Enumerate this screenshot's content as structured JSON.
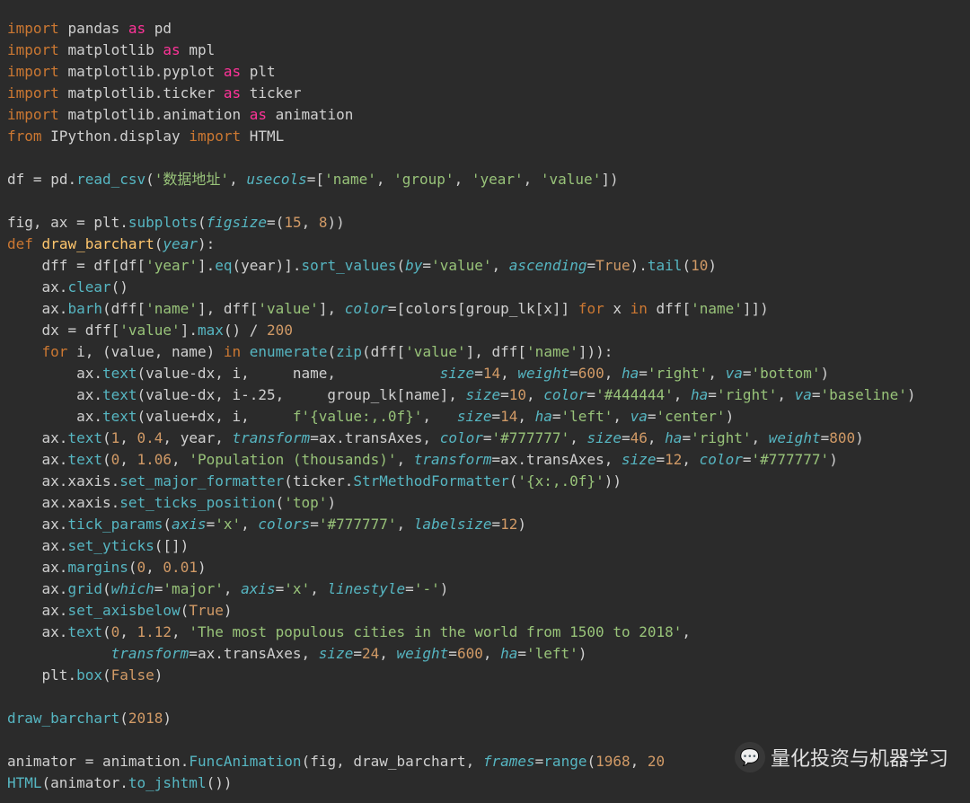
{
  "code": {
    "lines": [
      {
        "kind": "import_as",
        "kw": "import",
        "mod": "pandas",
        "as": "as",
        "alias": "pd"
      },
      {
        "kind": "import_as",
        "kw": "import",
        "mod": "matplotlib",
        "as": "as",
        "alias": "mpl"
      },
      {
        "kind": "import_as",
        "kw": "import",
        "mod": "matplotlib.pyplot",
        "as": "as",
        "alias": "plt"
      },
      {
        "kind": "import_as",
        "kw": "import",
        "mod": "matplotlib.ticker",
        "as": "as",
        "alias": "ticker"
      },
      {
        "kind": "import_as",
        "kw": "import",
        "mod": "matplotlib.animation",
        "as": "as",
        "alias": "animation"
      },
      {
        "kind": "from_import",
        "kw": "from",
        "mod": "IPython.display",
        "imp": "import",
        "name": "HTML"
      },
      {
        "kind": "blank"
      },
      {
        "kind": "assign_read",
        "lhs": "df",
        "eq": "=",
        "obj": "pd",
        "method": "read_csv",
        "args_str": "'数据地址'",
        "kw1": "usecols",
        "kw1val": "['name', 'group', 'year', 'value']"
      },
      {
        "kind": "blank"
      },
      {
        "kind": "subplots",
        "lhs": "fig, ax",
        "eq": "=",
        "obj": "plt",
        "method": "subplots",
        "kw1": "figsize",
        "kw1val": "(15, 8)"
      },
      {
        "kind": "def",
        "kw": "def",
        "name": "draw_barchart",
        "params": "year"
      },
      {
        "kind": "dff_line",
        "indent": 1,
        "lhs": "dff",
        "eq": "=",
        "expr_prefix": "df[df[",
        "key1": "'year'",
        "mid1": "].",
        "fn1": "eq",
        "mid2": "(year)].",
        "fn2": "sort_values",
        "kw_by": "by",
        "kw_by_v": "'value'",
        "kw_asc": "ascending",
        "kw_asc_v": "True",
        "tail": "tail",
        "tail_n": "10"
      },
      {
        "kind": "call0",
        "indent": 1,
        "obj": "ax",
        "method": "clear"
      },
      {
        "kind": "barh",
        "indent": 1,
        "obj": "ax",
        "method": "barh",
        "a1": "dff['name']",
        "a2": "dff['value']",
        "kw": "color",
        "kwv_prefix": "[colors[group_lk[x]] ",
        "for": "for",
        "x": "x",
        "in": "in",
        "tail": " dff['name']]"
      },
      {
        "kind": "dx",
        "indent": 1,
        "lhs": "dx",
        "eq": "=",
        "obj": "dff['value']",
        "method": "max",
        "suffix": "() / ",
        "num": "200"
      },
      {
        "kind": "for_enum",
        "indent": 1,
        "kw": "for",
        "vars": "i, (value, name)",
        "in": "in",
        "fn": "enumerate",
        "inner": "zip",
        "args": "dff['value'], dff['name']"
      },
      {
        "kind": "text_call",
        "indent": 2,
        "obj": "ax",
        "method": "text",
        "a1": "value-dx",
        "a2": "i",
        "pad2": "",
        "a3": "name",
        "pad3": "           ",
        "kws": [
          [
            "size",
            "14"
          ],
          [
            "weight",
            "600"
          ],
          [
            "ha",
            "'right'"
          ],
          [
            "va",
            "'bottom'"
          ]
        ]
      },
      {
        "kind": "text_call",
        "indent": 2,
        "obj": "ax",
        "method": "text",
        "a1": "value-dx",
        "a2": "i-.25",
        "a3": "group_lk[name]",
        "pad3": "",
        "kws": [
          [
            "size",
            "10"
          ],
          [
            "color",
            "'#444444'"
          ],
          [
            "ha",
            "'right'"
          ],
          [
            "va",
            "'baseline'"
          ]
        ]
      },
      {
        "kind": "text_call_f",
        "indent": 2,
        "obj": "ax",
        "method": "text",
        "a1": "value+dx",
        "a2": "i",
        "pad2": "",
        "fstr": "f'{value:,.0f}'",
        "pad3": "  ",
        "kws": [
          [
            "size",
            "14"
          ],
          [
            "ha",
            "'left'"
          ],
          [
            "va",
            "'center'"
          ]
        ]
      },
      {
        "kind": "text_big",
        "indent": 1,
        "obj": "ax",
        "method": "text",
        "a1": "1",
        "a2": "0.4",
        "a3": "year",
        "kws": [
          [
            "transform",
            "ax.transAxes"
          ],
          [
            "color",
            "'#777777'"
          ],
          [
            "size",
            "46"
          ],
          [
            "ha",
            "'right'"
          ],
          [
            "weight",
            "800"
          ]
        ]
      },
      {
        "kind": "text_big",
        "indent": 1,
        "obj": "ax",
        "method": "text",
        "a1": "0",
        "a2": "1.06",
        "a3": "'Population (thousands)'",
        "a3_is_str": true,
        "kws": [
          [
            "transform",
            "ax.transAxes"
          ],
          [
            "size",
            "12"
          ],
          [
            "color",
            "'#777777'"
          ]
        ]
      },
      {
        "kind": "formatter",
        "indent": 1,
        "obj": "ax.xaxis",
        "method": "set_major_formatter",
        "inner": "ticker.StrMethodFormatter",
        "arg": "'{x:,.0f}'"
      },
      {
        "kind": "call_str",
        "indent": 1,
        "obj": "ax.xaxis",
        "method": "set_ticks_position",
        "arg": "'top'"
      },
      {
        "kind": "tick_params",
        "indent": 1,
        "obj": "ax",
        "method": "tick_params",
        "kws": [
          [
            "axis",
            "'x'"
          ],
          [
            "colors",
            "'#777777'"
          ],
          [
            "labelsize",
            "12"
          ]
        ]
      },
      {
        "kind": "call_raw",
        "indent": 1,
        "obj": "ax",
        "method": "set_yticks",
        "raw": "[]"
      },
      {
        "kind": "margins",
        "indent": 1,
        "obj": "ax",
        "method": "margins",
        "a1": "0",
        "a2": "0.01"
      },
      {
        "kind": "grid",
        "indent": 1,
        "obj": "ax",
        "method": "grid",
        "kws": [
          [
            "which",
            "'major'"
          ],
          [
            "axis",
            "'x'"
          ],
          [
            "linestyle",
            "'-'"
          ]
        ]
      },
      {
        "kind": "call_const",
        "indent": 1,
        "obj": "ax",
        "method": "set_axisbelow",
        "arg": "True"
      },
      {
        "kind": "text_wrap1",
        "indent": 1,
        "obj": "ax",
        "method": "text",
        "a1": "0",
        "a2": "1.12",
        "a3": "'The most populous cities in the world from 1500 to 2018'"
      },
      {
        "kind": "text_wrap2",
        "indent": 3,
        "kws": [
          [
            "transform",
            "ax.transAxes"
          ],
          [
            "size",
            "24"
          ],
          [
            "weight",
            "600"
          ],
          [
            "ha",
            "'left'"
          ]
        ]
      },
      {
        "kind": "call_const",
        "indent": 1,
        "obj": "plt",
        "method": "box",
        "arg": "False"
      },
      {
        "kind": "blank"
      },
      {
        "kind": "call_num",
        "indent": 0,
        "fn": "draw_barchart",
        "arg": "2018"
      },
      {
        "kind": "blank"
      },
      {
        "kind": "animator",
        "lhs": "animator",
        "eq": "=",
        "obj": "animation",
        "method": "FuncAnimation",
        "args": "fig, draw_barchart",
        "kw": "frames",
        "kwv_fn": "range",
        "kwv_arg1": "1968",
        "kwv_arg2_obscured": "20"
      },
      {
        "kind": "html_call",
        "fn": "HTML",
        "inner_obj": "animator",
        "inner_method": "to_jshtml"
      }
    ]
  },
  "watermark": {
    "text": "量化投资与机器学习",
    "icon": "💬"
  }
}
